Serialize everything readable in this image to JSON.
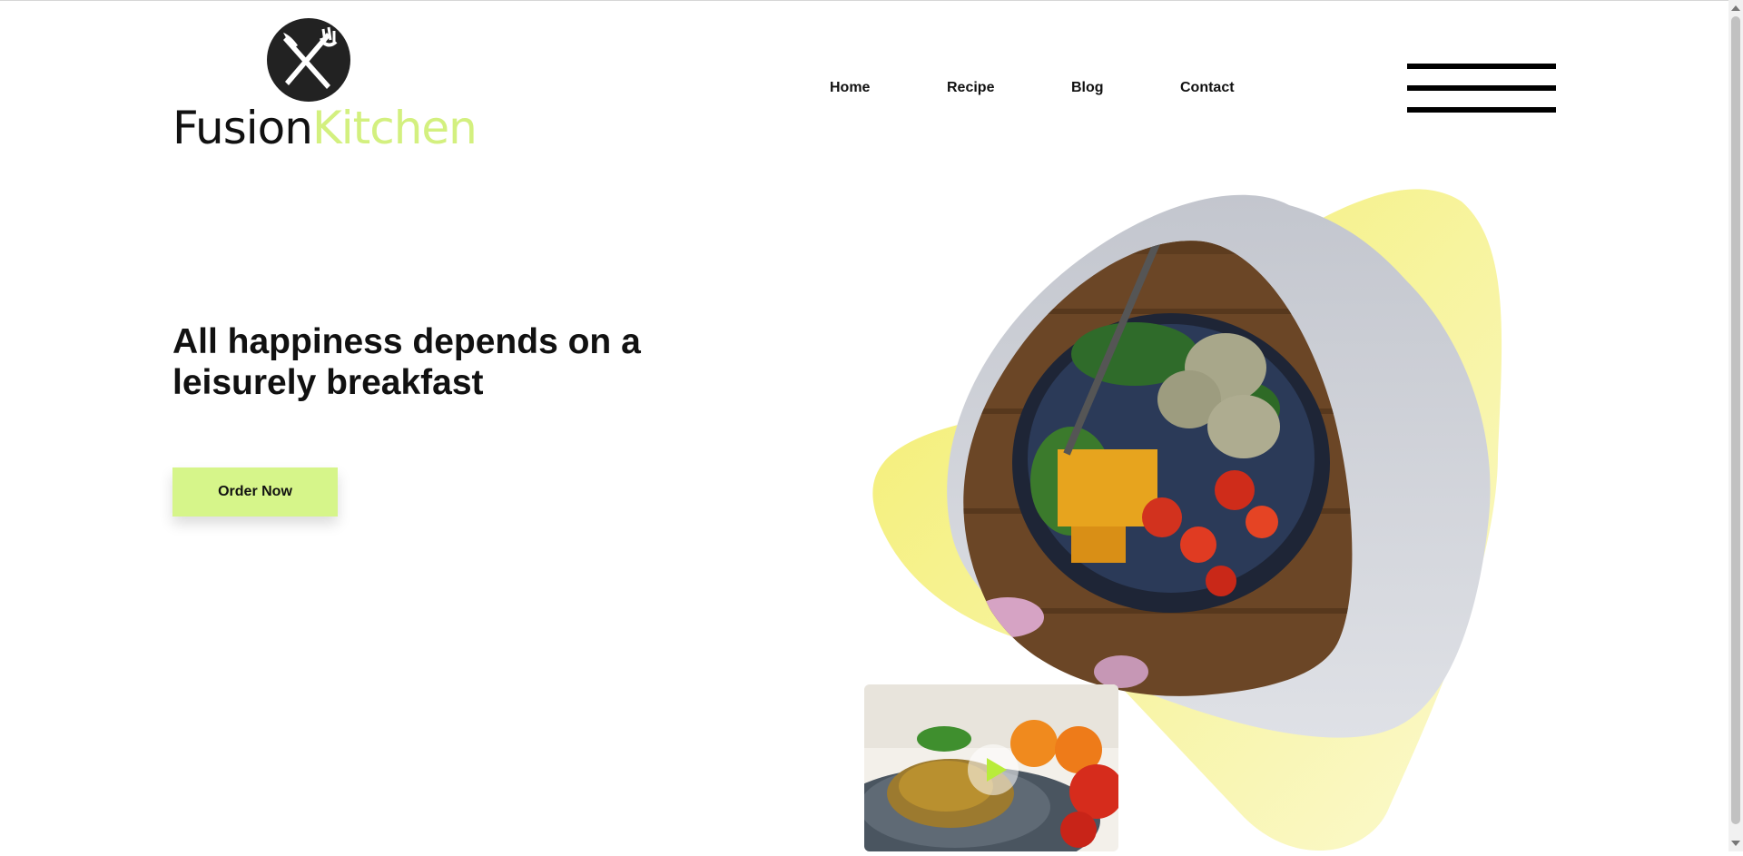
{
  "brand": {
    "name_part1": "Fusion",
    "name_part2": "Kitchen",
    "logo_icon": "crossed-knife-fork-icon",
    "accent_color": "#d3f07f"
  },
  "nav": {
    "items": [
      {
        "label": "Home"
      },
      {
        "label": "Recipe"
      },
      {
        "label": "Blog"
      },
      {
        "label": "Contact"
      }
    ],
    "menu_icon": "hamburger-menu-icon"
  },
  "hero": {
    "headline": "All happiness depends on a leisurely breakfast",
    "cta_label": "Order Now",
    "cta_color": "#d6f58a",
    "main_image": "salad-bowl-photo",
    "video_thumbnail": "pasta-plate-photo",
    "video_icon": "play-icon"
  },
  "colors": {
    "yellow_blob": "#f5f07a",
    "grey_frame": "#c9ccd4"
  }
}
